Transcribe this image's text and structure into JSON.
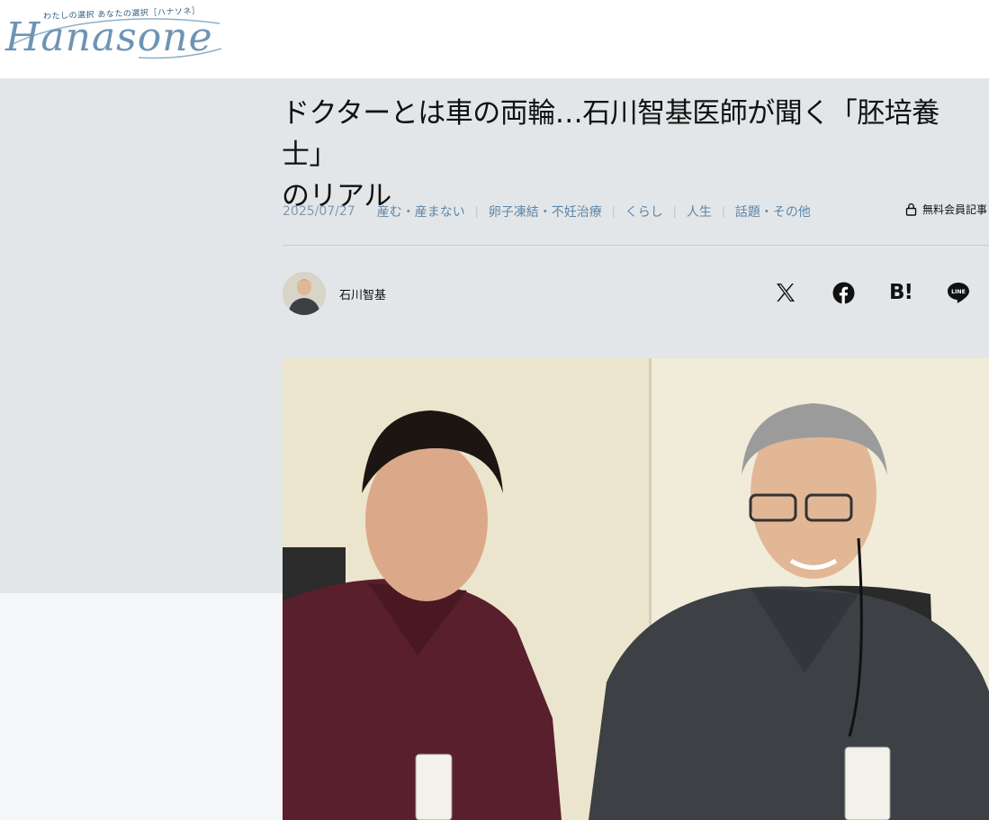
{
  "site": {
    "logo_tagline": "わたしの選択 あなたの選択［ハナソネ］",
    "logo_text": "Hanasone"
  },
  "article": {
    "title_line1": "ドクターとは車の両輪…石川智基医師が聞く「胚培養士」",
    "title_line2": "のリアル",
    "date": "2025/07/27",
    "categories": [
      "産む・産まない",
      "卵子凍結・不妊治療",
      "くらし",
      "人生",
      "話題・その他"
    ],
    "members_label": "無料会員記事"
  },
  "author": {
    "name": "石川智基"
  },
  "share": {
    "x_icon": "x-icon",
    "facebook_icon": "facebook-icon",
    "hatena_label": "B!",
    "line_label": "LINE"
  },
  "colors": {
    "accent": "#5d86a8",
    "band": "#e3e6e8",
    "logo": "#6e94b4"
  }
}
